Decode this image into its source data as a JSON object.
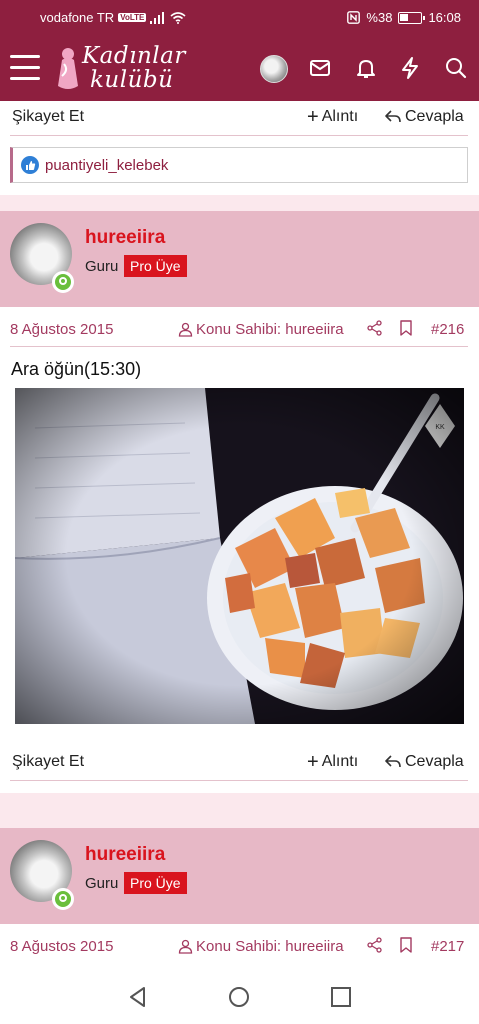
{
  "status_bar": {
    "carrier": "vodafone TR",
    "volte": "VoLTE",
    "battery_text": "%38",
    "time": "16:08"
  },
  "header": {
    "logo_line1": "Kadınlar",
    "logo_line2": "kulübü",
    "icons": [
      "menu-icon",
      "avatar",
      "envelope-icon",
      "bell-icon",
      "bolt-icon",
      "search-icon"
    ]
  },
  "prev_post": {
    "report": "Şikayet Et",
    "quote": "Alıntı",
    "reply": "Cevapla",
    "liked_by": "puantiyeli_kelebek"
  },
  "posts": [
    {
      "username": "hureeiira",
      "rank": "Guru",
      "badge": "Pro Üye",
      "date": "8 Ağustos 2015",
      "owner_label": "Konu Sahibi: hureeiira",
      "number": "#216",
      "text": "Ara öğün(15:30)",
      "report": "Şikayet Et",
      "quote": "Alıntı",
      "reply": "Cevapla",
      "image_watermark": "Kadınlar Kulübü"
    },
    {
      "username": "hureeiira",
      "rank": "Guru",
      "badge": "Pro Üye",
      "date": "8 Ağustos 2015",
      "owner_label": "Konu Sahibi: hureeiira",
      "number": "#217"
    }
  ],
  "colors": {
    "brand": "#8e1f3f",
    "user_block": "#e7b8c6",
    "username": "#d9141e",
    "meta_text": "#a33a60"
  }
}
